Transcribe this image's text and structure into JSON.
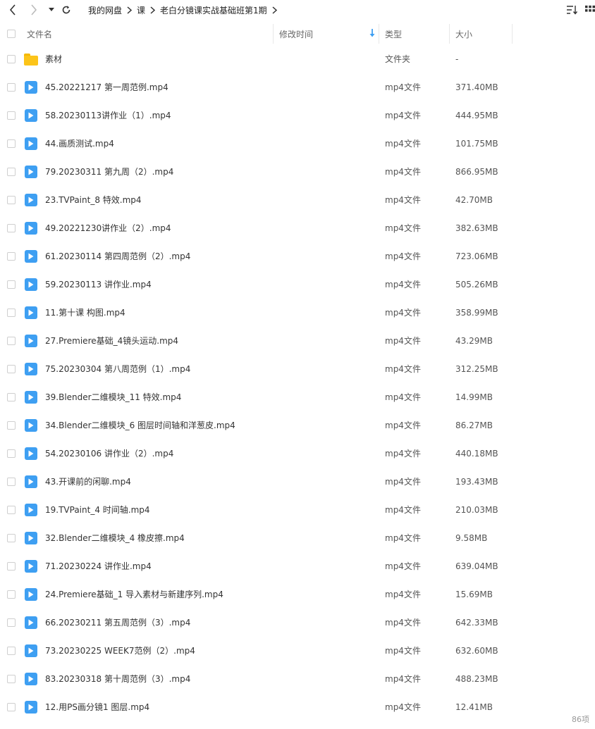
{
  "breadcrumb": [
    "我的网盘",
    "课",
    "老白分镜课实战基础班第1期"
  ],
  "columns": {
    "name": "文件名",
    "mtime": "修改时间",
    "type": "类型",
    "size": "大小"
  },
  "files": [
    {
      "name": "素材",
      "type": "文件夹",
      "size": "-",
      "icon": "folder-icon"
    },
    {
      "name": "45.20221217 第一周范例.mp4",
      "type": "mp4文件",
      "size": "371.40MB",
      "icon": "video-file-icon"
    },
    {
      "name": "58.20230113讲作业（1）.mp4",
      "type": "mp4文件",
      "size": "444.95MB",
      "icon": "video-file-icon"
    },
    {
      "name": "44.画质测试.mp4",
      "type": "mp4文件",
      "size": "101.75MB",
      "icon": "video-file-icon"
    },
    {
      "name": "79.20230311 第九周（2）.mp4",
      "type": "mp4文件",
      "size": "866.95MB",
      "icon": "video-file-icon"
    },
    {
      "name": "23.TVPaint_8 特效.mp4",
      "type": "mp4文件",
      "size": "42.70MB",
      "icon": "video-file-icon"
    },
    {
      "name": "49.20221230讲作业（2）.mp4",
      "type": "mp4文件",
      "size": "382.63MB",
      "icon": "video-file-icon"
    },
    {
      "name": "61.20230114 第四周范例（2）.mp4",
      "type": "mp4文件",
      "size": "723.06MB",
      "icon": "video-file-icon"
    },
    {
      "name": "59.20230113 讲作业.mp4",
      "type": "mp4文件",
      "size": "505.26MB",
      "icon": "video-file-icon"
    },
    {
      "name": "11.第十课 构图.mp4",
      "type": "mp4文件",
      "size": "358.99MB",
      "icon": "video-file-icon"
    },
    {
      "name": "27.Premiere基础_4镜头运动.mp4",
      "type": "mp4文件",
      "size": "43.29MB",
      "icon": "video-file-icon"
    },
    {
      "name": "75.20230304 第八周范例（1）.mp4",
      "type": "mp4文件",
      "size": "312.25MB",
      "icon": "video-file-icon"
    },
    {
      "name": "39.Blender二维模块_11 特效.mp4",
      "type": "mp4文件",
      "size": "14.99MB",
      "icon": "video-file-icon"
    },
    {
      "name": "34.Blender二维模块_6 图层时间轴和洋葱皮.mp4",
      "type": "mp4文件",
      "size": "86.27MB",
      "icon": "video-file-icon"
    },
    {
      "name": "54.20230106 讲作业（2）.mp4",
      "type": "mp4文件",
      "size": "440.18MB",
      "icon": "video-file-icon"
    },
    {
      "name": "43.开课前的闲聊.mp4",
      "type": "mp4文件",
      "size": "193.43MB",
      "icon": "video-file-icon"
    },
    {
      "name": "19.TVPaint_4 时间轴.mp4",
      "type": "mp4文件",
      "size": "210.03MB",
      "icon": "video-file-icon"
    },
    {
      "name": "32.Blender二维模块_4 橡皮擦.mp4",
      "type": "mp4文件",
      "size": "9.58MB",
      "icon": "video-file-icon"
    },
    {
      "name": "71.20230224 讲作业.mp4",
      "type": "mp4文件",
      "size": "639.04MB",
      "icon": "video-file-icon"
    },
    {
      "name": "24.Premiere基础_1 导入素材与新建序列.mp4",
      "type": "mp4文件",
      "size": "15.69MB",
      "icon": "video-file-icon"
    },
    {
      "name": "66.20230211 第五周范例（3）.mp4",
      "type": "mp4文件",
      "size": "642.33MB",
      "icon": "video-file-icon"
    },
    {
      "name": "73.20230225 WEEK7范例（2）.mp4",
      "type": "mp4文件",
      "size": "632.60MB",
      "icon": "video-file-icon"
    },
    {
      "name": "83.20230318 第十周范例（3）.mp4",
      "type": "mp4文件",
      "size": "488.23MB",
      "icon": "video-file-icon"
    },
    {
      "name": "12.用PS画分镜1 图层.mp4",
      "type": "mp4文件",
      "size": "12.41MB",
      "icon": "video-file-icon"
    }
  ],
  "status": {
    "item_count": "86项"
  },
  "colors": {
    "accent": "#3e9ff2",
    "folder": "#fcc419"
  }
}
